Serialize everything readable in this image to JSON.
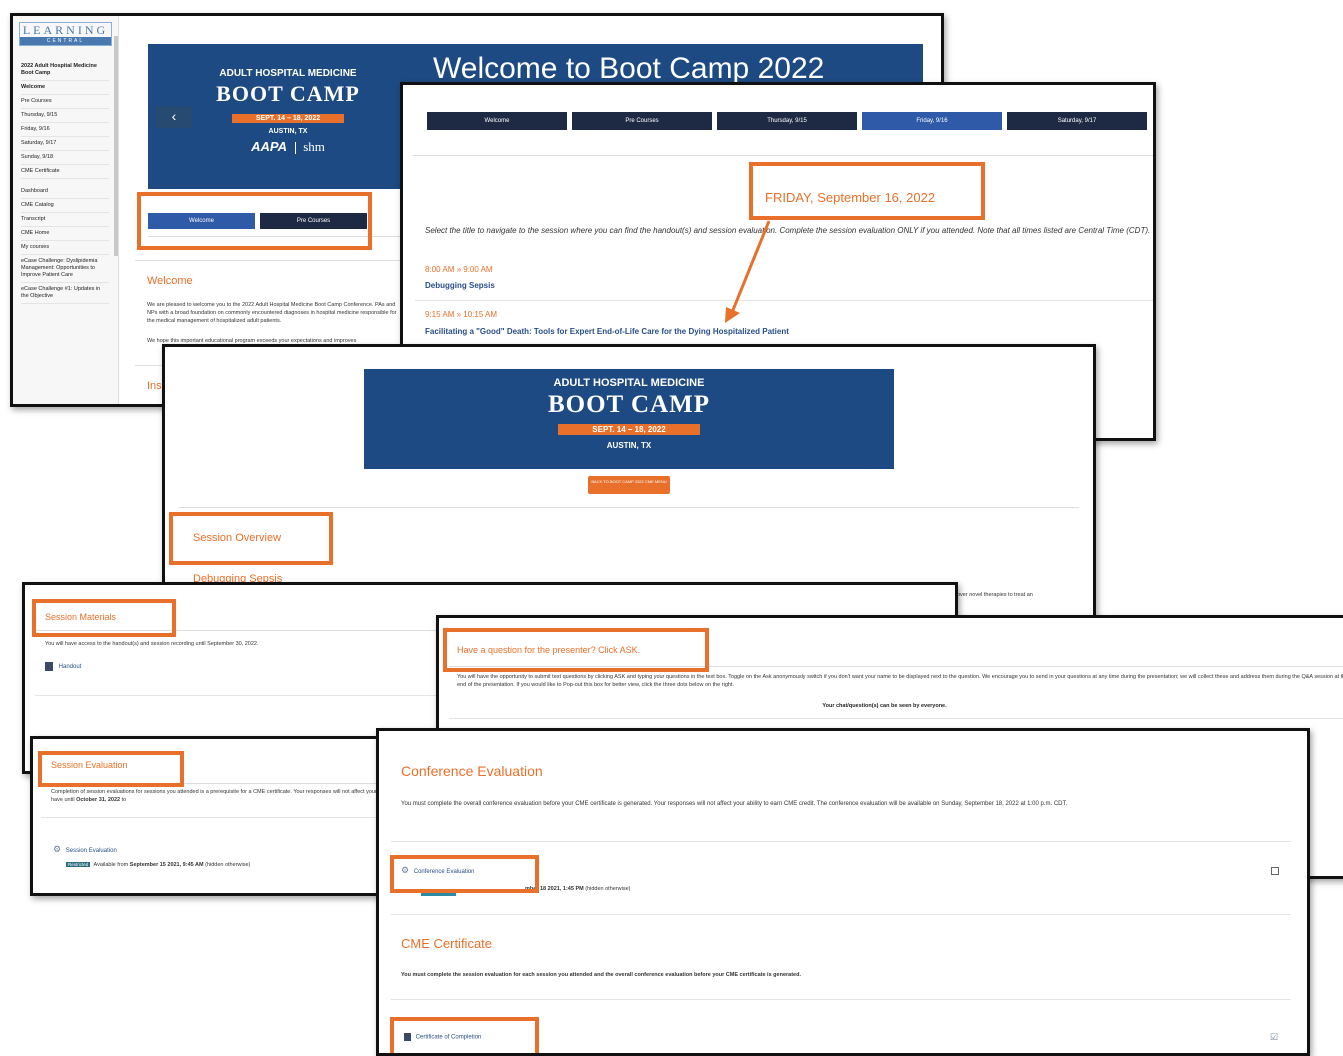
{
  "lms": {
    "logo_line1": "LEARNING",
    "logo_line2": "CENTRAL",
    "sidebar_items": [
      "2022 Adult Hospital Medicine Boot Camp",
      "Welcome",
      "Pre Courses",
      "Thursday, 9/15",
      "Friday, 9/16",
      "Saturday, 9/17",
      "Sunday, 9/18",
      "CME Certificate",
      "Dashboard",
      "CME Catalog",
      "Transcript",
      "CME Home",
      "My courses",
      "eCase Challenge: Dyslipidemia Management: Opportunities to Improve Patient Care",
      "eCase Challenge #1: Updates in the Objective"
    ],
    "banner": {
      "top": "ADULT HOSPITAL MEDICINE",
      "title": "BOOT CAMP",
      "dates": "SEPT. 14 – 18, 2022",
      "city": "AUSTIN, TX",
      "logo_a": "AAPA",
      "logo_b": "shm",
      "welcome_heading": "Welcome to Boot Camp 2022"
    },
    "prev_arrow": "‹",
    "tabs": [
      "Welcome",
      "Pre Courses"
    ],
    "welcome_title": "Welcome",
    "welcome_p1": "We are pleased to welcome you to the 2022 Adult Hospital Medicine Boot Camp Conference. PAs and NPs with a broad foundation on commonly encountered diagnoses in hospital medicine responsible for the medical management of hospitalized adult patients.",
    "welcome_p2": "We hope this important educational program exceeds your expectations and improves",
    "cut_heading": "Ins"
  },
  "schedule": {
    "tabs": [
      "Welcome",
      "Pre Courses",
      "Thursday, 9/15",
      "Friday, 9/16",
      "Saturday, 9/17"
    ],
    "active_tab": 3,
    "day_heading": "FRIDAY, September 16, 2022",
    "intro": "Select the title to navigate to the session where you can find the handout(s) and session evaluation. Complete the session evaluation ONLY if you attended. Note that all times listed are Central Time (CDT).",
    "sessions": [
      {
        "time": "8:00 AM » 9:00 AM",
        "title": "Debugging Sepsis"
      },
      {
        "time": "9:15 AM » 10:15 AM",
        "title": "Facilitating a \"Good\" Death: Tools for Expert End-of-Life Care for the Dying Hospitalized Patient"
      }
    ]
  },
  "session_page": {
    "banner_top": "ADULT HOSPITAL MEDICINE",
    "banner_title": "BOOT CAMP",
    "banner_dates": "SEPT. 14 – 18, 2022",
    "banner_city": "AUSTIN, TX",
    "back_button": "BACK TO BOOT CAMP 2022 CME MENU",
    "overview_heading": "Session Overview",
    "session_title": "Debugging Sepsis",
    "cut_text": "over novel therapies to treat an"
  },
  "materials": {
    "heading": "Session Materials",
    "text": "You will have access to the handout(s) and session recording until September 30, 2022.",
    "handout_label": "Handout"
  },
  "question": {
    "heading": "Have a question for the presenter? Click ASK.",
    "text": "You will have the opportunity to submit text questions by clicking ASK and typing your questions in the text box. Toggle on the Ask anonymously switch if you don't want your name to be displayed next to the question. We encourage you to send in your questions at any time during the presentation; we will collect these and address them during the Q&A session at the end of the presentation. If you would like to Pop-out this box for better view, click the three dots below on the right.",
    "visibility": "Your chat/question(s) can be seen by everyone."
  },
  "evaluation": {
    "heading": "Session Evaluation",
    "text_a": "Completion of session evaluations for sessions you attended is a prerequisite for a CME certificate. Your responses will not affect your ability to earn CME credit. You will have until ",
    "deadline": "October 31, 2022",
    "text_b": " to",
    "link": "Session Evaluation",
    "badge": "Restricted",
    "availability_a": "Available from ",
    "availability_date": "September 15 2021, 9:45 AM",
    "availability_b": " (hidden otherwise)"
  },
  "conference": {
    "heading": "Conference Evaluation",
    "text": "You must complete the overall conference evaluation before your CME certificate is generated. Your responses will not affect your ability to earn CME credit. The conference evaluation will be available on Sunday, September 18, 2022 at 1:00 p.m. CDT.",
    "link": "Conference Evaluation",
    "availability_date": "mber 18 2021, 1:45 PM",
    "availability_b": " (hidden otherwise)",
    "cme_heading": "CME Certificate",
    "cme_text": "You must complete the session evaluation for each session you attended and the overall conference evaluation before your CME certificate is generated.",
    "cert_link": "Certificate of Completion"
  },
  "colors": {
    "accent": "#e8702a",
    "navy": "#1e2a44",
    "banner_blue": "#1d4a82",
    "active_tab": "#2e5aa8",
    "link_blue": "#2a4f8a"
  }
}
